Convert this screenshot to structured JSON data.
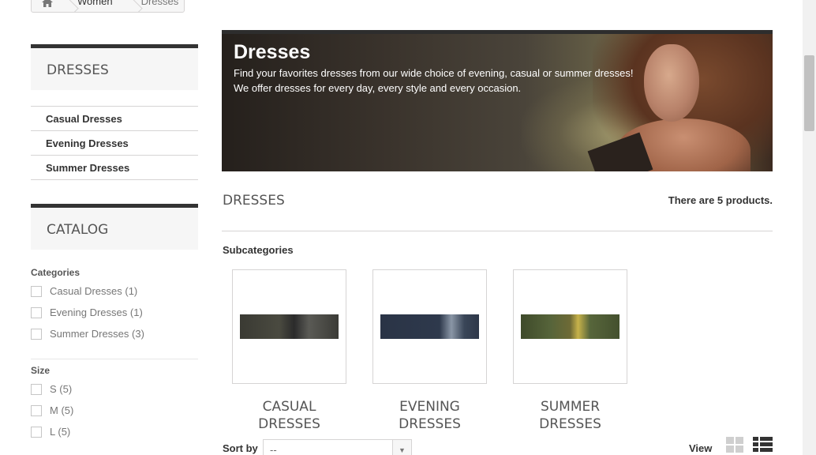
{
  "breadcrumb": {
    "items": [
      "Women",
      "Dresses"
    ]
  },
  "sidebar": {
    "block_title": "DRESSES",
    "subcategories": [
      "Casual Dresses",
      "Evening Dresses",
      "Summer Dresses"
    ],
    "catalog_title": "CATALOG",
    "categories_title": "Categories",
    "categories": [
      "Casual Dresses (1)",
      "Evening Dresses (1)",
      "Summer Dresses (3)"
    ],
    "size_title": "Size",
    "sizes": [
      "S (5)",
      "M (5)",
      "L (5)"
    ]
  },
  "banner": {
    "title": "Dresses",
    "line1": "Find your favorites dresses from our wide choice of evening, casual or summer dresses!",
    "line2": "We offer dresses for every day, every style and every occasion."
  },
  "content": {
    "category_name": "DRESSES",
    "product_count": "There are 5 products.",
    "subcategories_heading": "Subcategories",
    "subcategory_cards": [
      {
        "line1": "CASUAL",
        "line2": "DRESSES"
      },
      {
        "line1": "EVENING",
        "line2": "DRESSES"
      },
      {
        "line1": "SUMMER",
        "line2": "DRESSES"
      }
    ],
    "sort_label": "Sort by",
    "sort_value": "--",
    "view_label": "View"
  },
  "colors": {
    "accent": "#333333",
    "border": "#d6d4d4",
    "block_bg": "#f6f6f6"
  }
}
